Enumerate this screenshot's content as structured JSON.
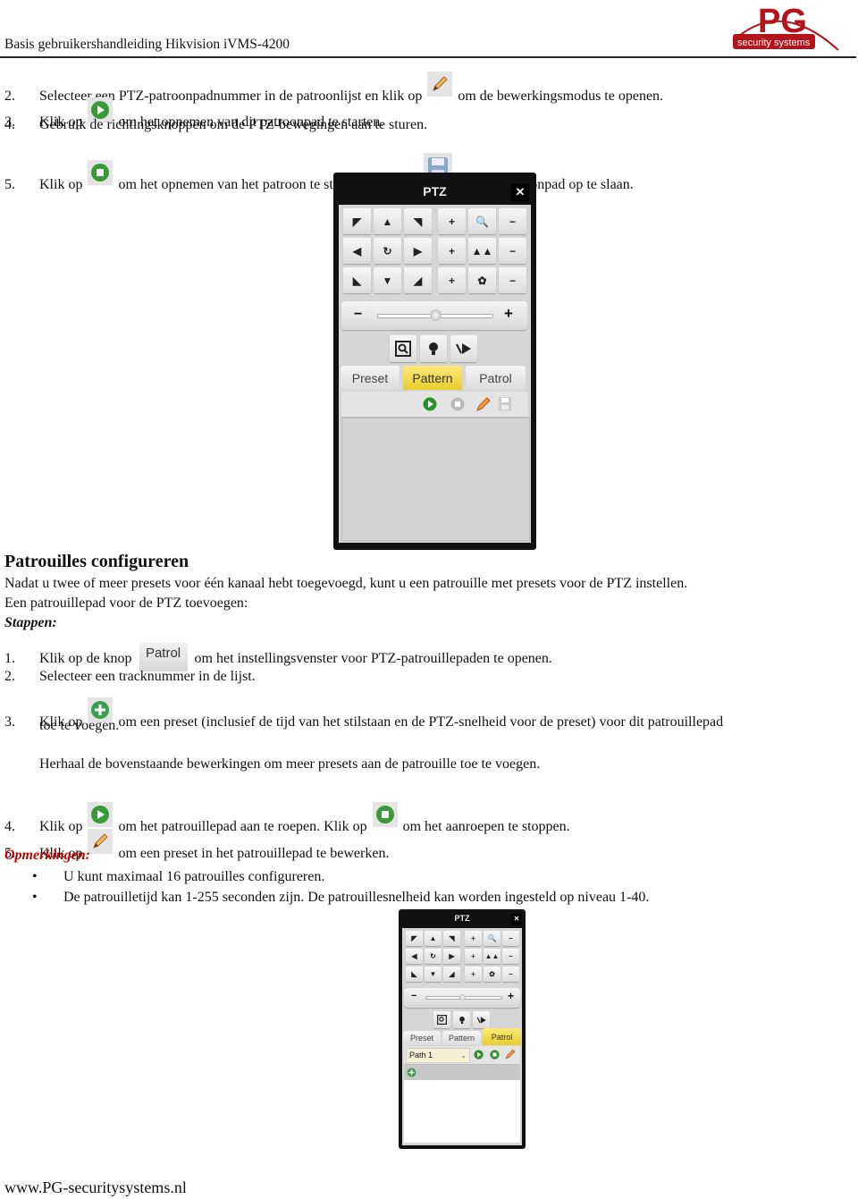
{
  "header": {
    "title": "Basis gebruikershandleiding Hikvision iVMS-4200",
    "logo_text": "security systems",
    "logo_letters": "PG",
    "brand_color": "#b5121b"
  },
  "pattern_steps": [
    {
      "num": "2.",
      "before": "Selecteer een PTZ-patroonpadnummer in de patroonlijst en klik op",
      "icon": "pencil-icon",
      "after": "om de bewerkingsmodus te openen."
    },
    {
      "num": "3.",
      "before": "Klik op",
      "icon": "play-icon",
      "after": "om het opnemen van dit patroonpad te starten."
    },
    {
      "num": "4.",
      "before": "Gebruik de richtingsknoppen om de PTZ-bewegingen aan te sturen.",
      "icon": "",
      "after": ""
    },
    {
      "num": "5.",
      "before": "Klik op",
      "icon": "stop-icon",
      "middle": "om het opnemen van het patroon te stoppen. Klik op",
      "icon2": "save-icon",
      "after": "om het patroonpad op te slaan."
    }
  ],
  "ptz_panel_1": {
    "title": "PTZ",
    "close": "✕",
    "tabs": [
      "Preset",
      "Pattern",
      "Patrol"
    ],
    "active_tab": "Pattern",
    "slider_value_pct": 50
  },
  "section": {
    "heading": "Patrouilles configureren",
    "intro": "Nadat u twee of meer presets voor één kanaal hebt toegevoegd, kunt u een patrouille met presets voor de PTZ instellen.",
    "sub": "Een patrouillepad voor de PTZ toevoegen:",
    "steps_label": "Stappen:"
  },
  "patrol_steps": {
    "s1_num": "1.",
    "s1_before": "Klik op de knop",
    "s1_button": "Patrol",
    "s1_after": "om het instellingsvenster voor PTZ-patrouillepaden te openen.",
    "s2_num": "2.",
    "s2_text": "Selecteer een tracknummer in de lijst.",
    "s3_num": "3.",
    "s3_before": "Klik op",
    "s3_after": "om een preset (inclusief de tijd van het stilstaan en de PTZ-snelheid voor de preset) voor dit patrouillepad",
    "s3_cont": "toe te voegen.",
    "repeat": "Herhaal de bovenstaande bewerkingen om meer presets aan de patrouille toe te voegen.",
    "s4_num": "4.",
    "s4_before": "Klik op",
    "s4_middle": "om het patrouillepad aan te roepen. Klik op",
    "s4_after": "om het aanroepen te stoppen.",
    "s5_num": "5.",
    "s5_before": "Klik op",
    "s5_after": "om een preset in het patrouillepad te bewerken."
  },
  "notes": {
    "label": "Opmerkingen:",
    "items": [
      "U kunt maximaal 16 patrouilles configureren.",
      "De patrouilletijd kan 1-255 seconden zijn. De patrouillesnelheid kan worden ingesteld op niveau 1-40."
    ]
  },
  "ptz_panel_2": {
    "title": "PTZ",
    "close": "✕",
    "tabs": [
      "Preset",
      "Pattern",
      "Patrol"
    ],
    "active_tab": "Patrol",
    "path_select": "Path 1",
    "slider_value_pct": 50
  },
  "footer": {
    "url": "www.PG-securitysystems.nl"
  }
}
